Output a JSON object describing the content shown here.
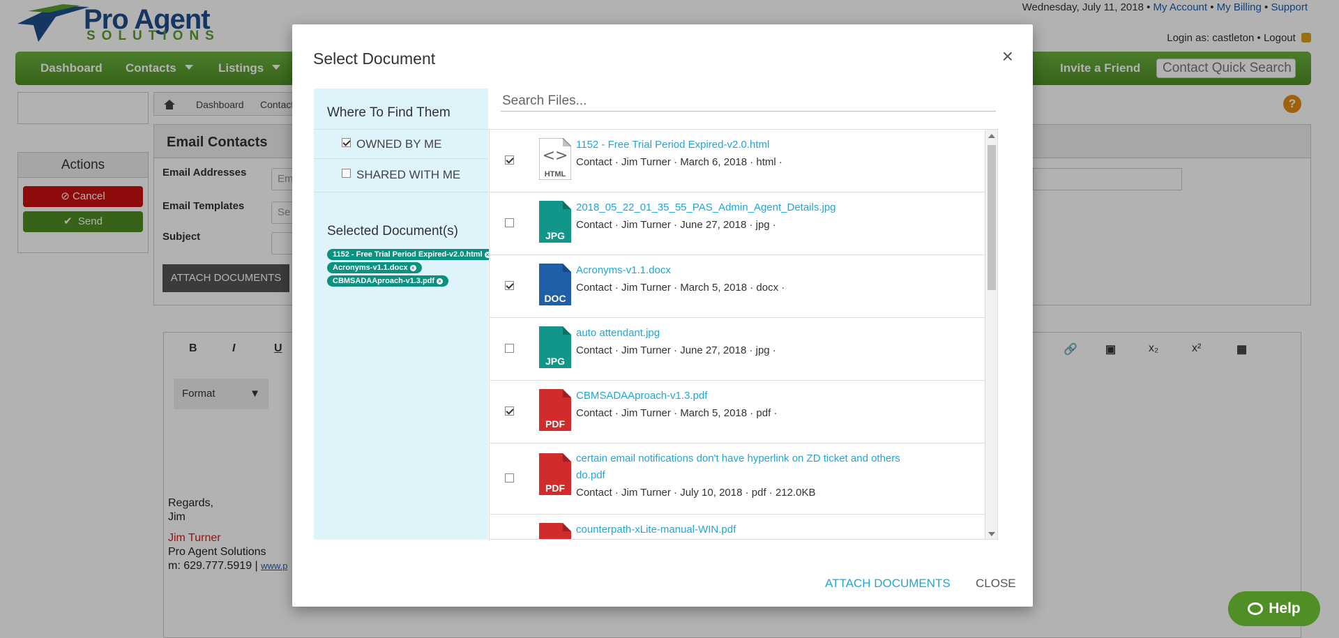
{
  "header": {
    "logo_line1": "Pro Agent",
    "logo_line2": "SOLUTIONS",
    "date": "Wednesday, July 11, 2018",
    "my_account": "My Account",
    "my_billing": "My Billing",
    "support": "Support",
    "login_as": "Login as: castleton",
    "logout": "Logout"
  },
  "nav": {
    "items": [
      "Dashboard",
      "Contacts",
      "Listings"
    ],
    "invite": "Invite a Friend",
    "quick_search_placeholder": "Contact Quick Search"
  },
  "breadcrumb": {
    "dashboard": "Dashboard",
    "contacts": "Contact"
  },
  "actions": {
    "title": "Actions",
    "cancel": "Cancel",
    "send": "Send"
  },
  "email": {
    "heading": "Email Contacts",
    "addresses_label": "Email Addresses",
    "addresses_placeholder": "Em",
    "templates_label": "Email Templates",
    "templates_placeholder": "Se",
    "subject_label": "Subject",
    "attach_button": "ATTACH DOCUMENTS"
  },
  "editor": {
    "bold": "B",
    "italic": "I",
    "underline": "U",
    "format": "Format",
    "regards": "Regards,",
    "first_name": "Jim",
    "sig_name": "Jim Turner",
    "sig_company": "Pro Agent Solutions",
    "sig_phone": "m: 629.777.5919 |",
    "sig_link": "www.p"
  },
  "modal": {
    "title": "Select Document",
    "close_glyph": "×",
    "where_heading": "Where To Find Them",
    "owned_by_me": "OWNED BY ME",
    "shared_with_me": "SHARED WITH ME",
    "selected_heading": "Selected Document(s)",
    "search_placeholder": "Search Files...",
    "selected_tags": [
      "1152 - Free Trial Period Expired-v2.0.html",
      "Acronyms-v1.1.docx",
      "CBMSADAAproach-v1.3.pdf"
    ],
    "files": [
      {
        "name": "1152 - Free Trial Period Expired-v2.0.html",
        "meta": "Contact · Jim Turner · March 6, 2018 · html ·",
        "type": "HTML",
        "checked": true
      },
      {
        "name": "2018_05_22_01_35_55_PAS_Admin_Agent_Details.jpg",
        "meta": "Contact · Jim Turner · June 27, 2018 · jpg ·",
        "type": "JPG",
        "checked": false
      },
      {
        "name": "Acronyms-v1.1.docx",
        "meta": "Contact · Jim Turner · March 5, 2018 · docx ·",
        "type": "DOC",
        "checked": true
      },
      {
        "name": "auto attendant.jpg",
        "meta": "Contact · Jim Turner · June 27, 2018 · jpg ·",
        "type": "JPG",
        "checked": false
      },
      {
        "name": "CBMSADAAproach-v1.3.pdf",
        "meta": "Contact · Jim Turner · March 5, 2018 · pdf ·",
        "type": "PDF",
        "checked": true
      },
      {
        "name": "certain email notifications don't have hyperlink on ZD ticket and others do.pdf",
        "meta": "Contact · Jim Turner · July 10, 2018 · pdf · 212.0KB",
        "type": "PDF",
        "checked": false
      },
      {
        "name": "counterpath-xLite-manual-WIN.pdf",
        "meta": "",
        "type": "PDF",
        "checked": false
      }
    ],
    "attach_button": "ATTACH DOCUMENTS",
    "close_button": "CLOSE"
  },
  "help": {
    "label": "Help"
  },
  "colors": {
    "brand_green": "#4f8f25",
    "brand_blue": "#1f4e8c",
    "link_blue": "#1fa6d8",
    "tag_teal": "#0a9180",
    "pdf_red": "#d22b2b",
    "jpg_teal": "#13968a",
    "doc_blue": "#1f5fa8"
  }
}
